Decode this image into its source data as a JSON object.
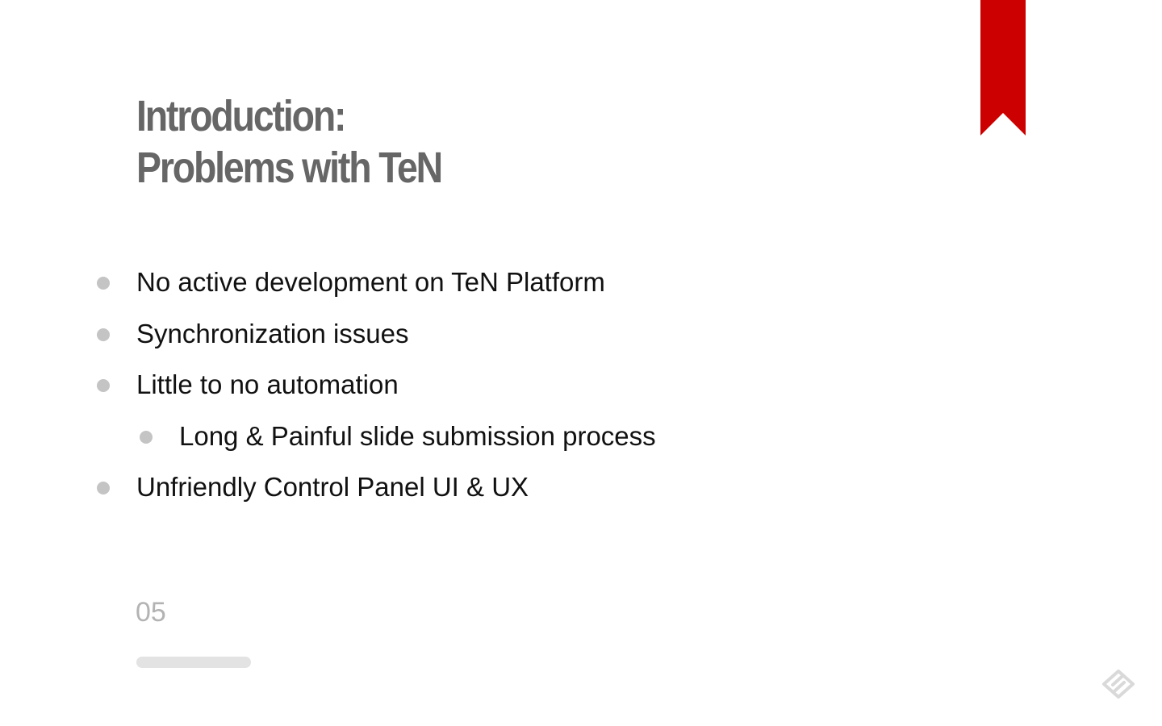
{
  "slide": {
    "title_line1": "Introduction:",
    "title_line2": "Problems with TeN",
    "bullets": [
      {
        "text": "No active development on TeN Platform",
        "level": 1
      },
      {
        "text": "Synchronization issues",
        "level": 1
      },
      {
        "text": "Little to no automation",
        "level": 1
      },
      {
        "text": "Long & Painful slide submission process",
        "level": 2
      },
      {
        "text": "Unfriendly Control Panel UI & UX",
        "level": 1
      }
    ],
    "page_number": "05",
    "progress_fraction": 1.0
  },
  "icons": {
    "bookmark": "bookmark-ribbon-icon",
    "logo": "app-logo-icon"
  },
  "colors": {
    "accent": "#cc0000",
    "title": "#666666",
    "text": "#111111",
    "muted": "#b3b3b3",
    "bullet": "#c4c4c4"
  }
}
